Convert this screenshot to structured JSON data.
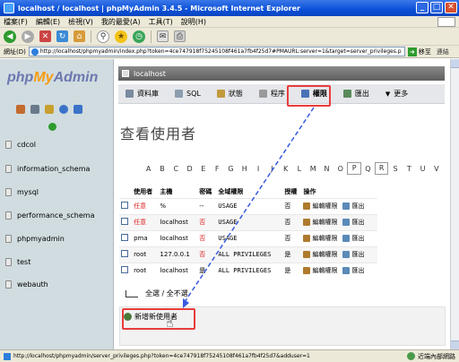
{
  "window": {
    "title": "localhost / localhost | phpMyAdmin 3.4.5 - Microsoft Internet Explorer",
    "minimize": "_",
    "maximize": "□",
    "close": "✕"
  },
  "menu": [
    "檔案(F)",
    "編輯(E)",
    "檢視(V)",
    "我的最愛(A)",
    "工具(T)",
    "說明(H)"
  ],
  "address": {
    "label": "網址(D)",
    "url": "http://localhost/phpmyadmin/index.php?token=4ce747918f75245108f461a7fb4f25d7#PMAURL:server=1&target=server_privileges.p",
    "go_label": "移至",
    "links_label": "連結"
  },
  "sidebar": {
    "logo": {
      "php": "php",
      "my": "My",
      "admin": "Admin"
    },
    "databases": [
      "cdcol",
      "information_schema",
      "mysql",
      "performance_schema",
      "phpmyadmin",
      "test",
      "webauth"
    ]
  },
  "main": {
    "server_label": "localhost",
    "tabs": [
      {
        "label": "資料庫"
      },
      {
        "label": "SQL"
      },
      {
        "label": "狀態"
      },
      {
        "label": "程序"
      },
      {
        "label": "權限"
      },
      {
        "label": "匯出"
      },
      {
        "label": "更多"
      }
    ],
    "page_title": "查看使用者",
    "letters": [
      "A",
      "B",
      "C",
      "D",
      "E",
      "F",
      "G",
      "H",
      "I",
      "J",
      "K",
      "L",
      "M",
      "N",
      "O",
      "P",
      "Q",
      "R",
      "S",
      "T",
      "U",
      "V"
    ],
    "table": {
      "headers": [
        "",
        "使用者",
        "主機",
        "密碼",
        "全域權限",
        "授權",
        "操作"
      ],
      "rows": [
        {
          "user": "任意",
          "host": "%",
          "password": "--",
          "privs": "USAGE",
          "grant": "否",
          "edit": "編輯權限",
          "export": "匯出"
        },
        {
          "user": "任意",
          "host": "localhost",
          "password": "否",
          "privs": "USAGE",
          "grant": "否",
          "edit": "編輯權限",
          "export": "匯出"
        },
        {
          "user": "pma",
          "host": "localhost",
          "password": "否",
          "privs": "USAGE",
          "grant": "否",
          "edit": "編輯權限",
          "export": "匯出"
        },
        {
          "user": "root",
          "host": "127.0.0.1",
          "password": "否",
          "privs": "ALL PRIVILEGES",
          "grant": "是",
          "edit": "編輯權限",
          "export": "匯出"
        },
        {
          "user": "root",
          "host": "localhost",
          "password": "是",
          "privs": "ALL PRIVILEGES",
          "grant": "是",
          "edit": "編輯權限",
          "export": "匯出"
        }
      ]
    },
    "select_all": "全選 / 全不選",
    "add_user": "新增新使用者"
  },
  "status": {
    "url": "http://localhost/phpmyadmin/server_privileges.php?token=4ce747918f75245108f461a7fb4f25d7&adduser=1",
    "zone": "近端內部網路"
  },
  "colors": {
    "highlight": "#e83c3c",
    "arrow": "#3a5ae0"
  }
}
